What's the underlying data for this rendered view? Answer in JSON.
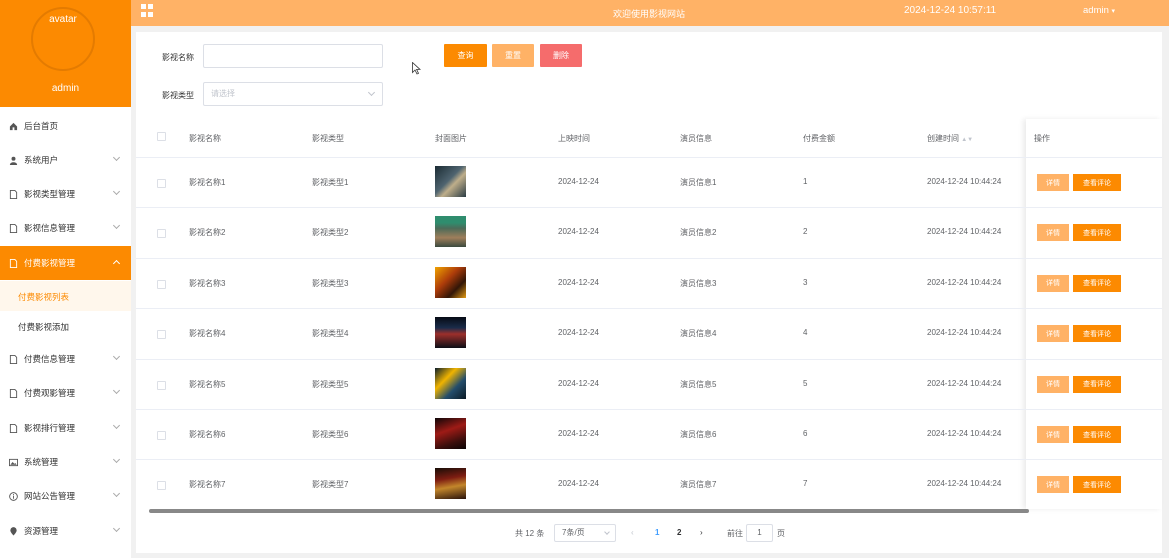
{
  "sidebar": {
    "avatar_alt": "avatar",
    "username": "admin",
    "menu": [
      {
        "label": "后台首页",
        "icon": "home-icon"
      },
      {
        "label": "系统用户",
        "icon": "user-icon"
      },
      {
        "label": "影视类型管理",
        "icon": "document-icon"
      },
      {
        "label": "影视信息管理",
        "icon": "document-icon"
      },
      {
        "label": "付费影视管理",
        "icon": "document-icon"
      },
      {
        "label": "付费影视列表"
      },
      {
        "label": "付费影视添加"
      },
      {
        "label": "付费信息管理",
        "icon": "document-icon"
      },
      {
        "label": "付费观影管理",
        "icon": "document-icon"
      },
      {
        "label": "影视排行管理",
        "icon": "document-icon"
      },
      {
        "label": "系统管理",
        "icon": "picture-icon"
      },
      {
        "label": "网站公告管理",
        "icon": "info-icon"
      },
      {
        "label": "资源管理",
        "icon": "location-icon"
      }
    ]
  },
  "header": {
    "title": "欢迎使用影视网站",
    "datetime": "2024-12-24 10:57:11",
    "user": "admin"
  },
  "search": {
    "name_label": "影视名称",
    "name_value": "",
    "type_label": "影视类型",
    "type_placeholder": "请选择",
    "query_btn": "查询",
    "reset_btn": "重置",
    "delete_btn": "删除"
  },
  "table": {
    "columns": [
      "影视名称",
      "影视类型",
      "封面图片",
      "上映时间",
      "演员信息",
      "付费金额",
      "创建时间",
      "操作"
    ],
    "detail_btn": "详情",
    "comment_btn": "查看评论",
    "rows": [
      {
        "name": "影视名称1",
        "type": "影视类型1",
        "date": "2024-12-24",
        "actor": "演员信息1",
        "price": "1",
        "created": "2024-12-24 10:44:24"
      },
      {
        "name": "影视名称2",
        "type": "影视类型2",
        "date": "2024-12-24",
        "actor": "演员信息2",
        "price": "2",
        "created": "2024-12-24 10:44:24"
      },
      {
        "name": "影视名称3",
        "type": "影视类型3",
        "date": "2024-12-24",
        "actor": "演员信息3",
        "price": "3",
        "created": "2024-12-24 10:44:24"
      },
      {
        "name": "影视名称4",
        "type": "影视类型4",
        "date": "2024-12-24",
        "actor": "演员信息4",
        "price": "4",
        "created": "2024-12-24 10:44:24"
      },
      {
        "name": "影视名称5",
        "type": "影视类型5",
        "date": "2024-12-24",
        "actor": "演员信息5",
        "price": "5",
        "created": "2024-12-24 10:44:24"
      },
      {
        "name": "影视名称6",
        "type": "影视类型6",
        "date": "2024-12-24",
        "actor": "演员信息6",
        "price": "6",
        "created": "2024-12-24 10:44:24"
      },
      {
        "name": "影视名称7",
        "type": "影视类型7",
        "date": "2024-12-24",
        "actor": "演员信息7",
        "price": "7",
        "created": "2024-12-24 10:44:24"
      }
    ]
  },
  "pagination": {
    "total": "共 12 条",
    "page_size": "7条/页",
    "pages": [
      "1",
      "2"
    ],
    "goto_label": "前往",
    "goto_value": "1",
    "page_suffix": "页"
  },
  "colors": {
    "primary": "#fc8a01",
    "topbar": "#ffb266",
    "reset": "#ffb266",
    "delete": "#f56c6c",
    "detail": "#ffb266"
  }
}
